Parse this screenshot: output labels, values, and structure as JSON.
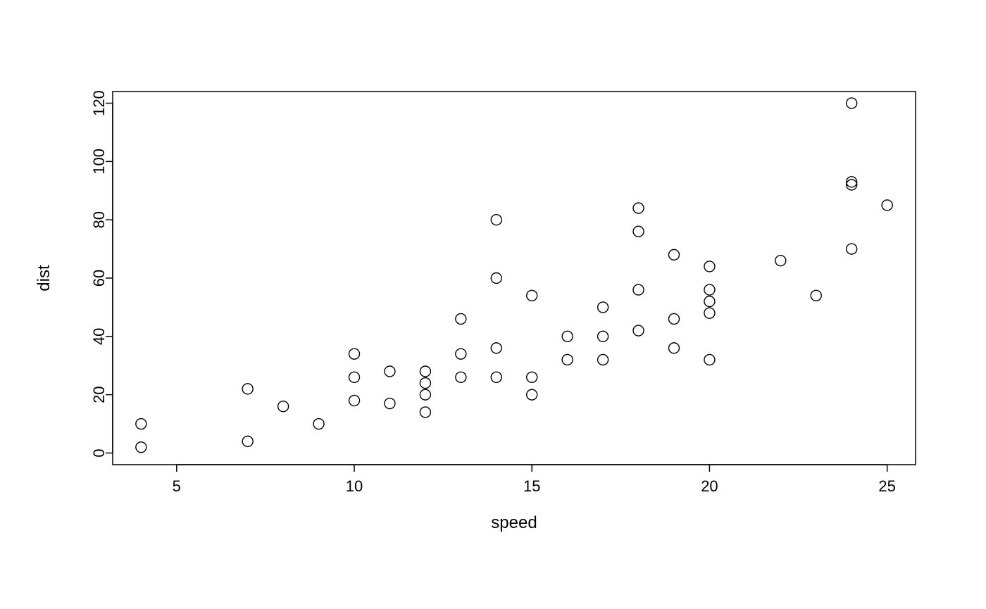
{
  "chart_data": {
    "type": "scatter",
    "xlabel": "speed",
    "ylabel": "dist",
    "xlim": [
      3.2,
      25.8
    ],
    "ylim": [
      -4,
      124
    ],
    "x_ticks": [
      5,
      10,
      15,
      20,
      25
    ],
    "y_ticks": [
      0,
      20,
      40,
      60,
      80,
      100,
      120
    ],
    "points": [
      {
        "x": 4,
        "y": 2
      },
      {
        "x": 4,
        "y": 10
      },
      {
        "x": 7,
        "y": 4
      },
      {
        "x": 7,
        "y": 22
      },
      {
        "x": 8,
        "y": 16
      },
      {
        "x": 9,
        "y": 10
      },
      {
        "x": 10,
        "y": 18
      },
      {
        "x": 10,
        "y": 26
      },
      {
        "x": 10,
        "y": 34
      },
      {
        "x": 11,
        "y": 17
      },
      {
        "x": 11,
        "y": 28
      },
      {
        "x": 12,
        "y": 14
      },
      {
        "x": 12,
        "y": 20
      },
      {
        "x": 12,
        "y": 24
      },
      {
        "x": 12,
        "y": 28
      },
      {
        "x": 13,
        "y": 26
      },
      {
        "x": 13,
        "y": 34
      },
      {
        "x": 13,
        "y": 46
      },
      {
        "x": 14,
        "y": 26
      },
      {
        "x": 14,
        "y": 36
      },
      {
        "x": 14,
        "y": 60
      },
      {
        "x": 14,
        "y": 80
      },
      {
        "x": 15,
        "y": 20
      },
      {
        "x": 15,
        "y": 26
      },
      {
        "x": 15,
        "y": 54
      },
      {
        "x": 16,
        "y": 32
      },
      {
        "x": 16,
        "y": 40
      },
      {
        "x": 17,
        "y": 32
      },
      {
        "x": 17,
        "y": 40
      },
      {
        "x": 17,
        "y": 50
      },
      {
        "x": 18,
        "y": 42
      },
      {
        "x": 18,
        "y": 56
      },
      {
        "x": 18,
        "y": 76
      },
      {
        "x": 18,
        "y": 84
      },
      {
        "x": 19,
        "y": 36
      },
      {
        "x": 19,
        "y": 46
      },
      {
        "x": 19,
        "y": 68
      },
      {
        "x": 20,
        "y": 32
      },
      {
        "x": 20,
        "y": 48
      },
      {
        "x": 20,
        "y": 52
      },
      {
        "x": 20,
        "y": 56
      },
      {
        "x": 20,
        "y": 64
      },
      {
        "x": 22,
        "y": 66
      },
      {
        "x": 23,
        "y": 54
      },
      {
        "x": 24,
        "y": 70
      },
      {
        "x": 24,
        "y": 92
      },
      {
        "x": 24,
        "y": 93
      },
      {
        "x": 24,
        "y": 120
      },
      {
        "x": 25,
        "y": 85
      }
    ]
  }
}
